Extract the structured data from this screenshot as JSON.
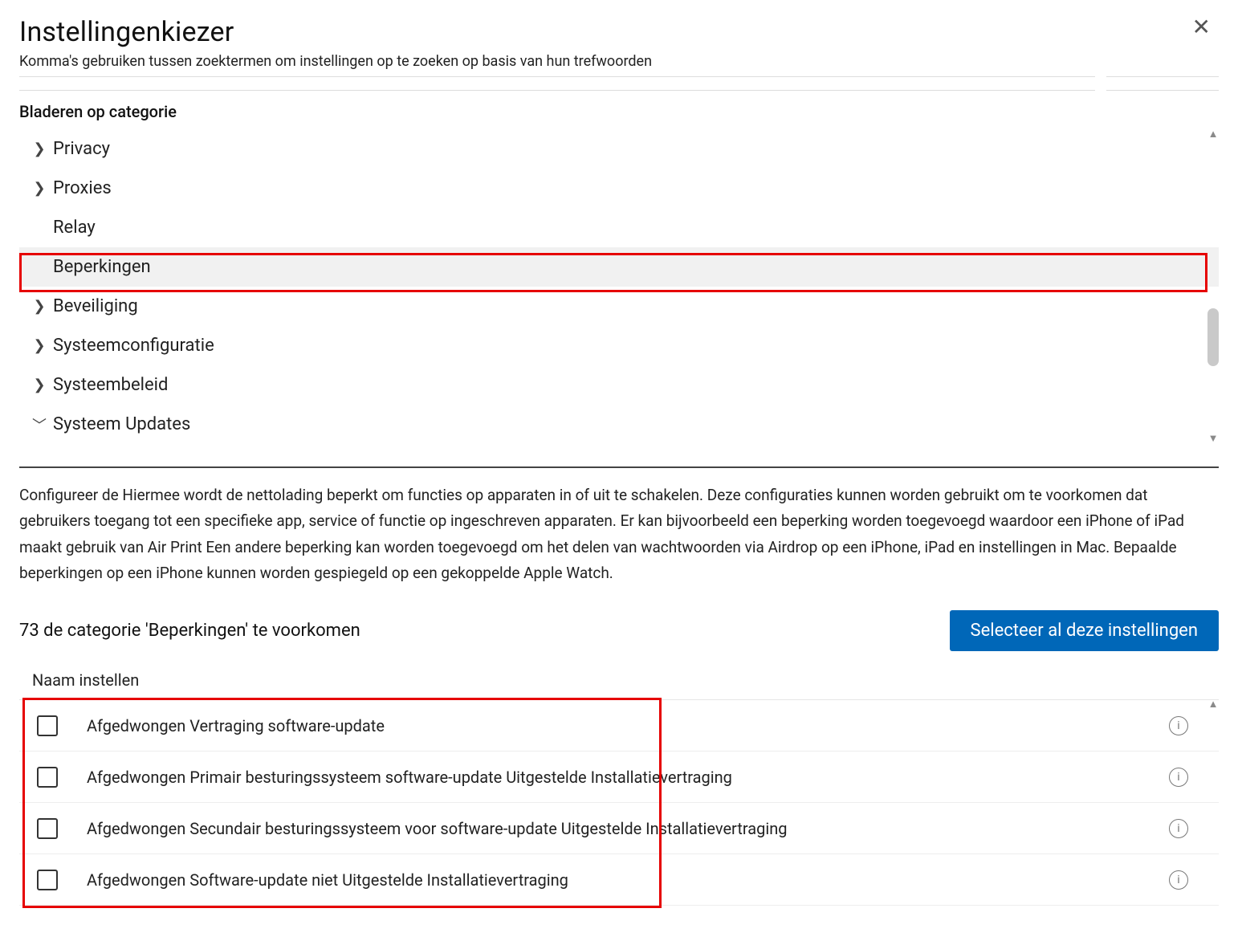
{
  "header": {
    "title": "Instellingenkiezer",
    "subtitle": "Komma's gebruiken  tussen zoektermen om instellingen op te zoeken op basis van hun trefwoorden"
  },
  "browse_label": "Bladeren op categorie",
  "tree": [
    {
      "label": "Privacy",
      "chevron": "right",
      "selected": false
    },
    {
      "label": "Proxies",
      "chevron": "right",
      "selected": false
    },
    {
      "label": "Relay",
      "chevron": "none",
      "selected": false
    },
    {
      "label": "Beperkingen",
      "chevron": "none",
      "selected": true
    },
    {
      "label": "Beveiliging",
      "chevron": "right",
      "selected": false
    },
    {
      "label": "Systeemconfiguratie",
      "chevron": "right",
      "selected": false
    },
    {
      "label": "Systeembeleid",
      "chevron": "right",
      "selected": false
    },
    {
      "label": "Systeem Updates",
      "chevron": "down",
      "selected": false
    }
  ],
  "description": "Configureer de   Hiermee wordt de nettolading beperkt om functies op apparaten in of uit te schakelen. Deze configuraties kunnen worden gebruikt om te voorkomen dat gebruikers toegang tot een specifieke app, service of functie op ingeschreven apparaten.      Er kan bijvoorbeeld een beperking worden toegevoegd waardoor een iPhone of iPad maakt gebruik van Air Print Een andere beperking kan worden toegevoegd om het delen van wachtwoorden via Airdrop op een iPhone, iPad en instellingen in     Mac. Bepaalde beperkingen op een iPhone kunnen worden gespiegeld op een gekoppelde Apple Watch.",
  "count_line": "73 de categorie 'Beperkingen' te voorkomen",
  "select_all_label": "Selecteer al deze instellingen",
  "column_header": "Naam instellen",
  "settings": [
    {
      "label": "Afgedwongen  Vertraging software-update"
    },
    {
      "label": "Afgedwongen  Primair besturingssysteem software-update    Uitgestelde  Installatievertraging"
    },
    {
      "label": "Afgedwongen  Secundair besturingssysteem voor software-update   Uitgestelde  Installatievertraging"
    },
    {
      "label": "Afgedwongen  Software-update niet            Uitgestelde  Installatievertraging"
    }
  ],
  "icons": {
    "close": "✕",
    "chev_right": "❯",
    "chev_down": "﹀",
    "up_arrow": "▲",
    "down_arrow": "▼",
    "info_glyph": "i"
  }
}
